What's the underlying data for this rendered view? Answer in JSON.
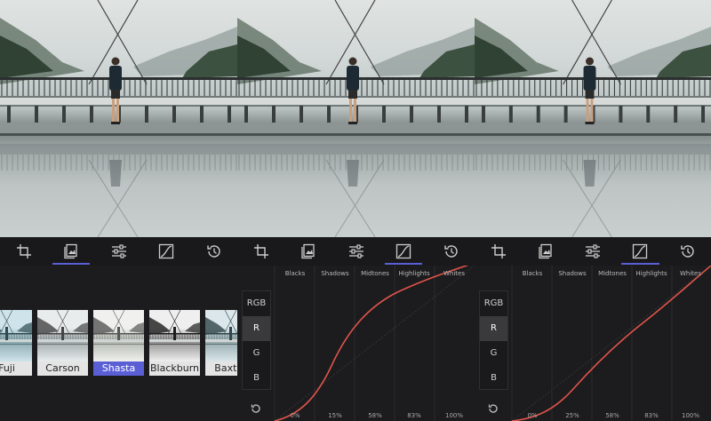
{
  "colors": {
    "accent": "#5b5fd6",
    "curve": "#e0544a",
    "background": "#1c1c1e"
  },
  "toolbar_icons": [
    "crop-icon",
    "filters-icon",
    "adjust-sliders-icon",
    "curves-icon",
    "history-icon"
  ],
  "panel1": {
    "active_tool": "filters",
    "filters": [
      {
        "label": "Fuji"
      },
      {
        "label": "Carson"
      },
      {
        "label": "Shasta",
        "selected": true
      },
      {
        "label": "Blackburn"
      },
      {
        "label": "Baxter"
      }
    ]
  },
  "panel2": {
    "active_tool": "curves",
    "channels": [
      "RGB",
      "R",
      "G",
      "B"
    ],
    "active_channel": "R",
    "zones": [
      "Blacks",
      "Shadows",
      "Midtones",
      "Highlights",
      "Whites"
    ],
    "percentages": [
      "0%",
      "15%",
      "58%",
      "83%",
      "100%"
    ]
  },
  "panel3": {
    "active_tool": "curves",
    "channels": [
      "RGB",
      "R",
      "G",
      "B"
    ],
    "active_channel": "R",
    "zones": [
      "Blacks",
      "Shadows",
      "Midtones",
      "Highlights",
      "Whites"
    ],
    "percentages": [
      "0%",
      "25%",
      "58%",
      "83%",
      "100%"
    ]
  }
}
